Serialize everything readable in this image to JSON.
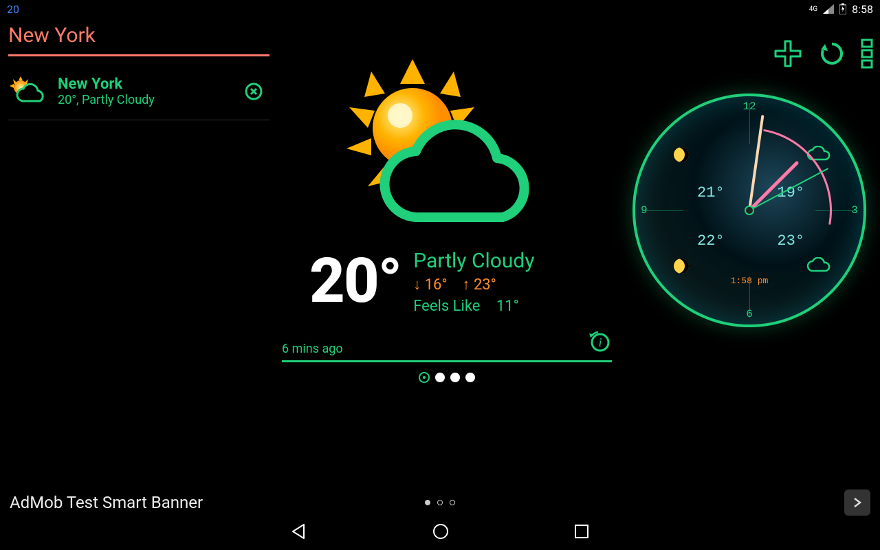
{
  "status": {
    "left_num": "20",
    "net": "4G",
    "time": "8:58"
  },
  "sidebar": {
    "header_city": "New York",
    "item": {
      "name": "New York",
      "summary": "20°, Partly Cloudy"
    }
  },
  "weather": {
    "temp": "20°",
    "condition": "Partly Cloudy",
    "low_arrow": "↓",
    "low": "16°",
    "high_arrow": "↑",
    "high": "23°",
    "feels_label": "Feels Like",
    "feels_val": "11°",
    "updated": "6 mins ago"
  },
  "clock": {
    "num_12": "12",
    "num_3": "3",
    "num_6": "6",
    "num_9": "9",
    "q1": "21°",
    "q2": "19°",
    "q3": "22°",
    "q4": "23°",
    "time_label": "1:58 pm"
  },
  "banner": {
    "text": "AdMob Test Smart Banner"
  }
}
